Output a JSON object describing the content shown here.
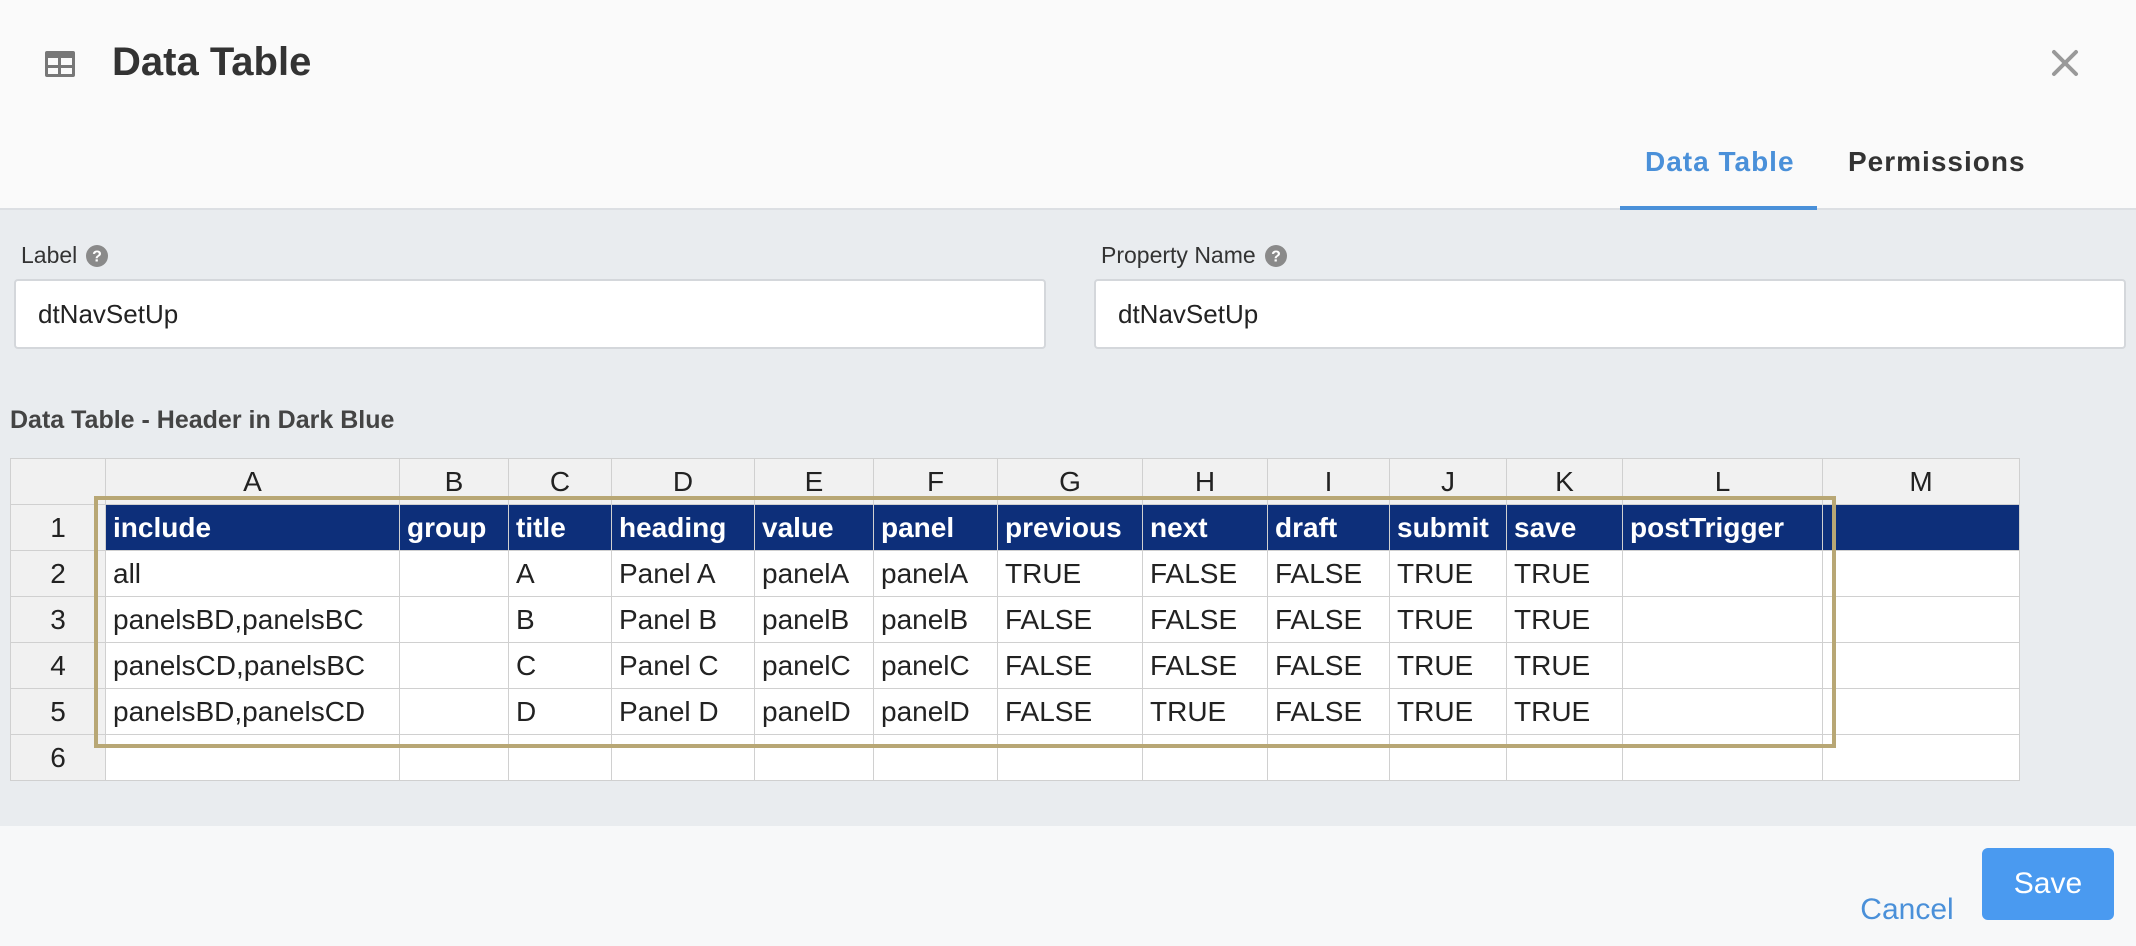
{
  "modal": {
    "title": "Data Table",
    "title_icon": "table-icon",
    "close_icon": "close-icon"
  },
  "tabs": [
    {
      "label": "Data Table",
      "active": true
    },
    {
      "label": "Permissions",
      "active": false
    }
  ],
  "fields": {
    "label": {
      "label": "Label",
      "value": "dtNavSetUp"
    },
    "property_name": {
      "label": "Property Name",
      "value": "dtNavSetUp"
    }
  },
  "section_label": "Data Table - Header in Dark Blue",
  "sheet": {
    "column_letters": [
      "A",
      "B",
      "C",
      "D",
      "E",
      "F",
      "G",
      "H",
      "I",
      "J",
      "K",
      "L",
      "M"
    ],
    "row_numbers": [
      "1",
      "2",
      "3",
      "4",
      "5",
      "6"
    ],
    "header": [
      "include",
      "group",
      "title",
      "heading",
      "value",
      "panel",
      "previous",
      "next",
      "draft",
      "submit",
      "save",
      "postTrigger",
      ""
    ],
    "rows": [
      [
        "all",
        "",
        "A",
        "Panel A",
        "panelA",
        "panelA",
        "TRUE",
        "FALSE",
        "FALSE",
        "TRUE",
        "TRUE",
        "",
        ""
      ],
      [
        "panelsBD,panelsBC",
        "",
        "B",
        "Panel B",
        "panelB",
        "panelB",
        "FALSE",
        "FALSE",
        "FALSE",
        "TRUE",
        "TRUE",
        "",
        ""
      ],
      [
        "panelsCD,panelsBC",
        "",
        "C",
        "Panel C",
        "panelC",
        "panelC",
        "FALSE",
        "FALSE",
        "FALSE",
        "TRUE",
        "TRUE",
        "",
        ""
      ],
      [
        "panelsBD,panelsCD",
        "",
        "D",
        "Panel D",
        "panelD",
        "panelD",
        "FALSE",
        "TRUE",
        "FALSE",
        "TRUE",
        "TRUE",
        "",
        ""
      ],
      [
        "",
        "",
        "",
        "",
        "",
        "",
        "",
        "",
        "",
        "",
        "",
        "",
        ""
      ]
    ]
  },
  "footer": {
    "cancel_label": "Cancel",
    "save_label": "Save"
  },
  "colors": {
    "accent": "#4a90d9",
    "header_row_bg": "#0d2f7a",
    "highlight_border": "#b8a775",
    "save_button": "#4a9af0"
  }
}
